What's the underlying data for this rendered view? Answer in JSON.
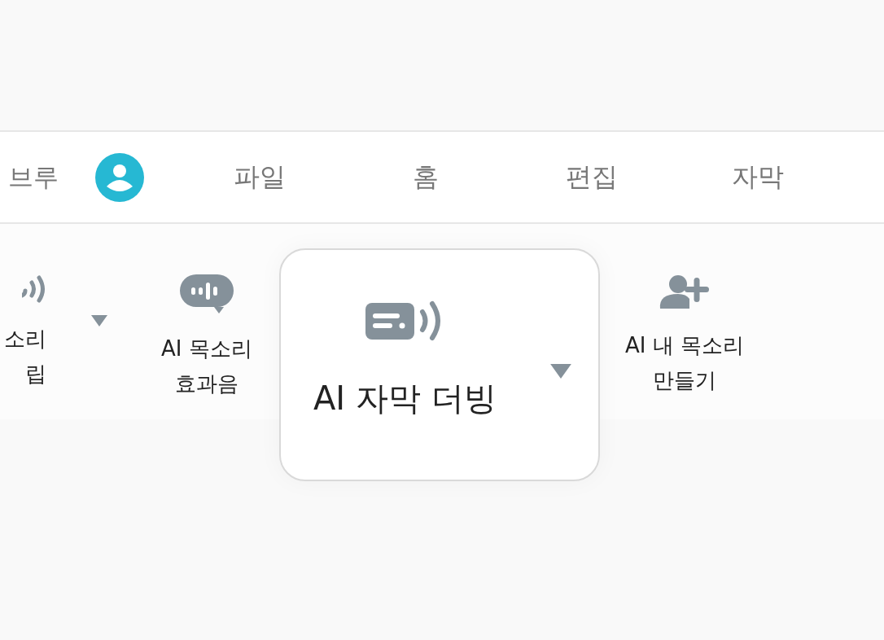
{
  "header": {
    "brand": "브루",
    "menu": [
      {
        "label": "파일"
      },
      {
        "label": "홈"
      },
      {
        "label": "편집"
      },
      {
        "label": "자막"
      }
    ]
  },
  "tools": [
    {
      "kind": "sound-wave",
      "lines": [
        "소리",
        "립"
      ],
      "dropdown": true,
      "highlighted": false
    },
    {
      "kind": "speech-bubble",
      "lines": [
        "AI 목소리",
        "효과음"
      ],
      "dropdown": false,
      "highlighted": false
    },
    {
      "kind": "caption-sound",
      "lines": [
        "AI 자막 더빙"
      ],
      "dropdown": true,
      "highlighted": true
    },
    {
      "kind": "person-add",
      "lines": [
        "AI 내 목소리",
        "만들기"
      ],
      "dropdown": false,
      "highlighted": false
    }
  ]
}
